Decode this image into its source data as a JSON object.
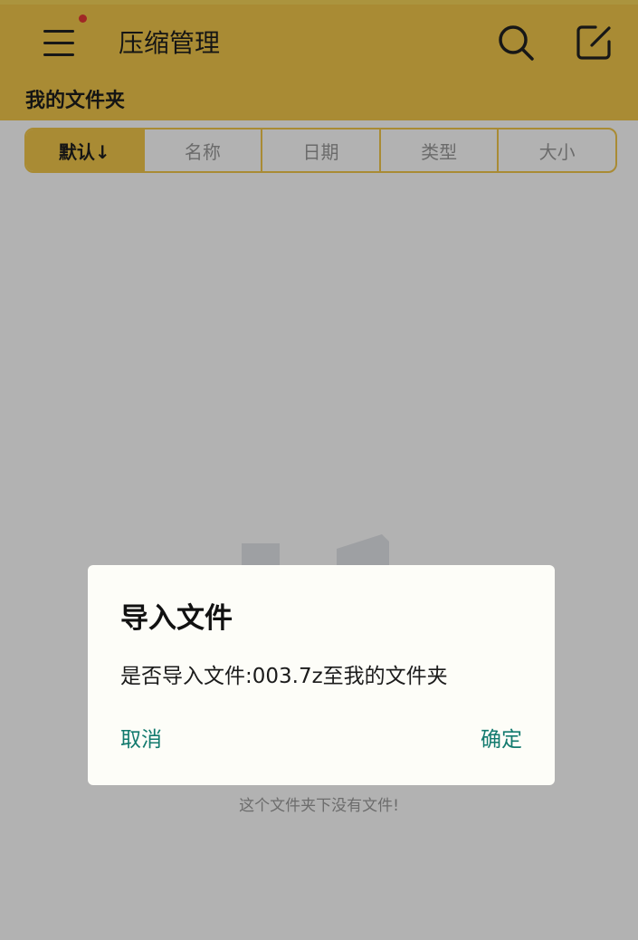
{
  "header": {
    "title": "压缩管理",
    "menu_icon": "menu-icon",
    "notification_dot_color": "#e53935",
    "search_icon": "search-icon",
    "edit_icon": "edit-icon",
    "background_color": "#f3c84b"
  },
  "folder": {
    "title": "我的文件夹"
  },
  "sort_tabs": [
    {
      "label": "默认↓",
      "active": true
    },
    {
      "label": "名称",
      "active": false
    },
    {
      "label": "日期",
      "active": false
    },
    {
      "label": "类型",
      "active": false
    },
    {
      "label": "大小",
      "active": false
    }
  ],
  "empty_state": {
    "illustration_icon": "empty-folder-icon",
    "text": "这个文件夹下没有文件!"
  },
  "dialog": {
    "title": "导入文件",
    "message": "是否导入文件:003.7z至我的文件夹",
    "cancel_label": "取消",
    "confirm_label": "确定",
    "button_color": "#127a6e"
  }
}
